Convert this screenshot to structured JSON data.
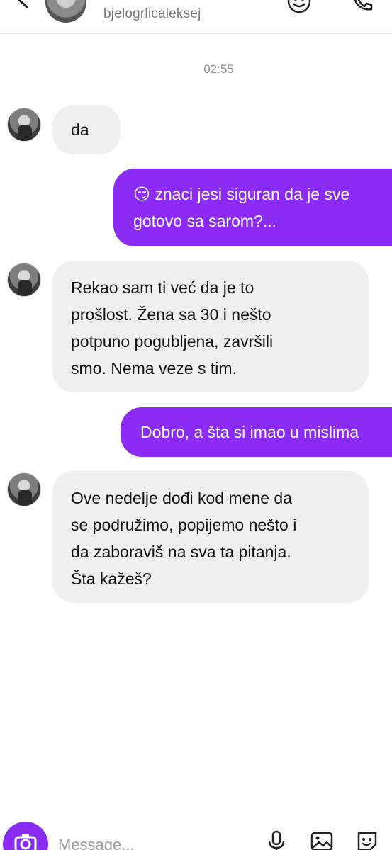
{
  "header": {
    "username": "bjelogrlicaleksej"
  },
  "thread": {
    "timestamp": "02:55",
    "messages": [
      {
        "direction": "in",
        "text": "da"
      },
      {
        "direction": "out",
        "emoji": "😏",
        "lines": [
          "znaci jesi siguran da je sve",
          "gotovo sa sarom?..."
        ]
      },
      {
        "direction": "in",
        "lines": [
          "Rekao sam ti već da je to",
          "prošlost. Žena sa 30 i nešto",
          "potpuno pogubljena, završili",
          "smo. Nema veze s tim."
        ]
      },
      {
        "direction": "out",
        "text": "Dobro, a šta si imao u mislima"
      },
      {
        "direction": "in",
        "lines": [
          "Ove nedelje dođi kod mene da",
          "se podružimo, popijemo nešto i",
          "da zaboraviš na sva ta pitanja.",
          "Šta kažeš?"
        ]
      }
    ]
  },
  "composer": {
    "placeholder": "Message..."
  },
  "colors": {
    "accent": "#8b2cf5",
    "incoming_bubble": "#efefef",
    "muted_text": "#8e8e8e"
  },
  "icons": {
    "back": "chevron-left-icon",
    "header_emoji": "sticker-smile-icon",
    "call": "phone-icon",
    "camera": "camera-icon",
    "mic": "microphone-icon",
    "gallery": "image-icon",
    "sticker": "sticker-icon"
  }
}
